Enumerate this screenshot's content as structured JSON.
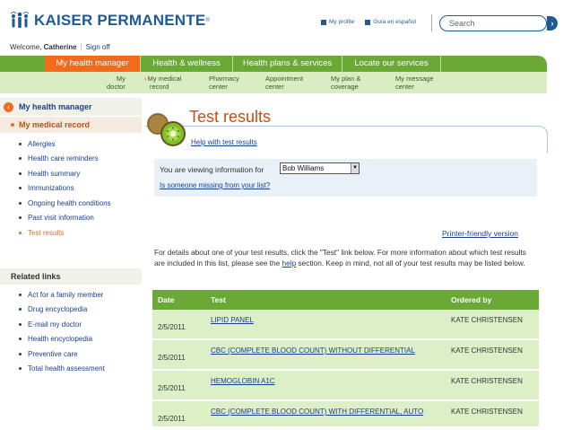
{
  "brand": {
    "name": "KAISER PERMANENTE",
    "reg": "®",
    "color": "#1e5b96"
  },
  "top_links": {
    "profile": "My profile",
    "spanish": "Guía en español"
  },
  "search": {
    "placeholder": "Search"
  },
  "welcome": {
    "prefix": "Welcome,",
    "user": "Catherine",
    "sign_off": "Sign off"
  },
  "nav": {
    "tabs": [
      {
        "label": "My health manager"
      },
      {
        "label": "Health & wellness"
      },
      {
        "label": "Health plans & services"
      },
      {
        "label": "Locate our services"
      }
    ]
  },
  "subnav": {
    "items": [
      {
        "line1": "My",
        "line2": "doctor"
      },
      {
        "line1": "My medical",
        "line2": "record"
      },
      {
        "line1": "Pharmacy",
        "line2": "center"
      },
      {
        "line1": "Appointment",
        "line2": "center"
      },
      {
        "line1": "My plan &",
        "line2": "coverage"
      },
      {
        "line1": "My message",
        "line2": "center"
      }
    ]
  },
  "sidebar": {
    "back_label": "My health manager",
    "section_label": "My medical record",
    "items": [
      "Allergies",
      "Health care reminders",
      "Health summary",
      "Immunizations",
      "Ongoing health conditions",
      "Past visit information",
      "Test results"
    ],
    "related_title": "Related links",
    "related_items": [
      "Act for a family member",
      "Drug encyclopedia",
      "E-mail my doctor",
      "Health encyclopedia",
      "Preventive care",
      "Total health assessment"
    ]
  },
  "main": {
    "title": "Test results",
    "help_link": "Help with test results",
    "viewing_label": "You are viewing information for",
    "viewing_value": "Bob Williams",
    "missing_link": "Is someone missing from your list?",
    "printer_link": "Printer-friendly version",
    "para_1": "For details about one of your test results, click the \"Test\" link below. For more information about which test results are included in this list, please see the",
    "para_help": "help",
    "para_2": "section. Keep in mind, not all of your test results may be listed below.",
    "table": {
      "headers": [
        "Date",
        "Test",
        "Ordered by"
      ],
      "rows": [
        {
          "date": "2/5/2011",
          "test": "LIPID PANEL",
          "ordered_by": "KATE CHRISTENSEN"
        },
        {
          "date": "2/5/2011",
          "test": "CBC (COMPLETE BLOOD COUNT) WITHOUT DIFFERENTIAL",
          "ordered_by": "KATE CHRISTENSEN"
        },
        {
          "date": "2/5/2011",
          "test": "HEMOGLOBIN A1C",
          "ordered_by": "KATE CHRISTENSEN"
        },
        {
          "date": "2/5/2011",
          "test": "CBC (COMPLETE BLOOD COUNT) WITH DIFFERENTIAL, AUTO",
          "ordered_by": "KATE CHRISTENSEN"
        }
      ]
    }
  },
  "colors": {
    "nav_green": "#6aa935",
    "active_orange": "#f26b1d",
    "subnav_green": "#d9ecc3",
    "row_green": "#dcefc6",
    "link_blue": "#1a3f8f"
  }
}
